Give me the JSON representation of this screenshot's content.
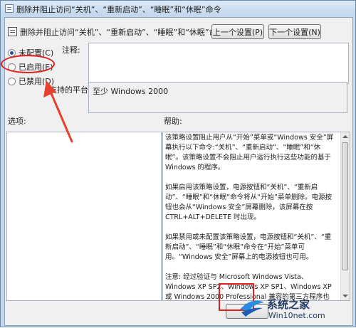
{
  "window": {
    "title": "删除并阻止访问“关机”、“重新启动”、“睡眠”和“休眠”命令"
  },
  "header": {
    "title": "删除并阻止访问“关机”、“重新启动”、“睡眠”和“休眠”命令",
    "prev_label": "上一个设置(P)",
    "next_label": "下一个设置(N)"
  },
  "radios": {
    "not_configured": "未配置(C)",
    "enabled": "已启用(E)",
    "disabled": "已禁用(D)",
    "selected": "not_configured"
  },
  "comment": {
    "label": "注释:"
  },
  "platform": {
    "label": "支持的平台:",
    "value": "至少 Windows 2000"
  },
  "options": {
    "label": "选项:"
  },
  "help": {
    "label": "帮助:",
    "paragraphs": [
      "该策略设置阻止用户从“开始”菜单或“Windows 安全”屏幕执行以下命令:“关机”、“重新启动”、“睡眠”和“休眠”。该策略设置不会阻止用户运行执行这些功能的基于 Windows 的程序。",
      "如果启用该策略设置，电源按钮和“关机”、“重新启动”、“睡眠”和“休眠”命令将从“开始”菜单删除。电源按钮也会从“Windows 安全”屏幕删除，该屏幕在按 CTRL+ALT+DELETE 时出现。",
      "如果禁用或未配置该策略设置，电源按钮和“关机”、“重新启动”、“睡眠”和“休眠”命令在“开始”菜单可用。“Windows 安全”屏幕上的电源按钮也可用。",
      "注意: 经过验证与 Microsoft Windows Vista、Windows XP SP2、Windows XP SP1、Windows XP 或 Windows 2000 Professional 兼容的第三方程序也要求支持该策略设置。"
    ]
  },
  "footer": {
    "ok_label": ""
  },
  "watermark": {
    "name": "系统之家",
    "url": "Win10net.com"
  },
  "colors": {
    "highlight": "#e02020",
    "arrow": "#e8402e"
  }
}
